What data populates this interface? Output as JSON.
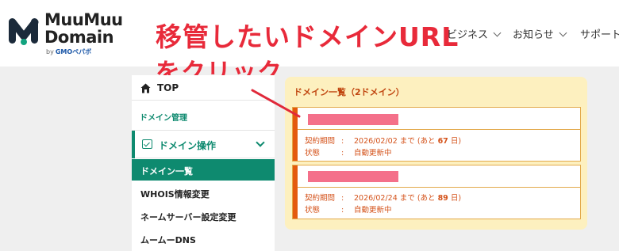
{
  "header": {
    "logo": {
      "line1": "MuuMuu",
      "line2": "Domain",
      "by": "by",
      "brand": "GMOペパボ",
      "brand_color": "#1a56a7"
    },
    "nav": [
      {
        "label": "ビジネス"
      },
      {
        "label": "お知らせ"
      },
      {
        "label": "サポート"
      }
    ]
  },
  "annotation": {
    "line1": "移管したいドメインURL",
    "line2": "をクリック",
    "color": "#e82a3a"
  },
  "sidebar": {
    "top_label": "TOP",
    "manage_label": "ドメイン管理",
    "ops_label": "ドメイン操作",
    "active_label": "ドメイン一覧",
    "items": [
      {
        "label": "WHOIS情報変更"
      },
      {
        "label": "ネームサーバー設定変更"
      },
      {
        "label": "ムームーDNS"
      }
    ],
    "accent": "#0e8a6f"
  },
  "domain_panel": {
    "title": "ドメイン一覧（2ドメイン）",
    "accent": "#e45a0e",
    "domains": [
      {
        "contract_label": "契約期間",
        "colon": ":",
        "expiry": "2026/02/02",
        "until": "まで (あと",
        "days": "67",
        "day_unit": "日)",
        "status_label": "状態",
        "status": "自動更新中"
      },
      {
        "contract_label": "契約期間",
        "colon": ":",
        "expiry": "2026/02/24",
        "until": "まで (あと",
        "days": "89",
        "day_unit": "日)",
        "status_label": "状態",
        "status": "自動更新中"
      }
    ]
  }
}
